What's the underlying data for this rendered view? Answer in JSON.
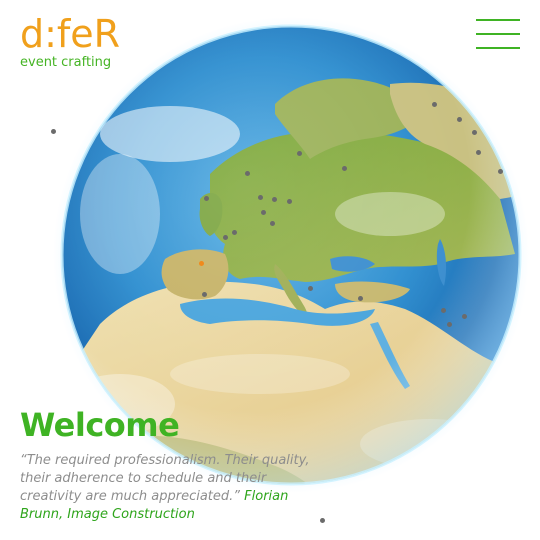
{
  "brand": {
    "logo_text": "d:feR",
    "tagline": "event crafting",
    "primary_color": "#f0a01c",
    "accent_color": "#3fb324"
  },
  "header": {
    "menu_icon": "hamburger-menu-icon"
  },
  "hero": {
    "heading": "Welcome",
    "quote_text": "“The required professionalism. Their quality, their adherence to schedule and their creativity are much appreciated.”",
    "quote_author": "Florian Brunn, Image Construction"
  },
  "globe": {
    "icon": "earth-globe-icon",
    "highlight_marker_color": "#f08a1c",
    "marker_color": "#6b6b6b"
  }
}
